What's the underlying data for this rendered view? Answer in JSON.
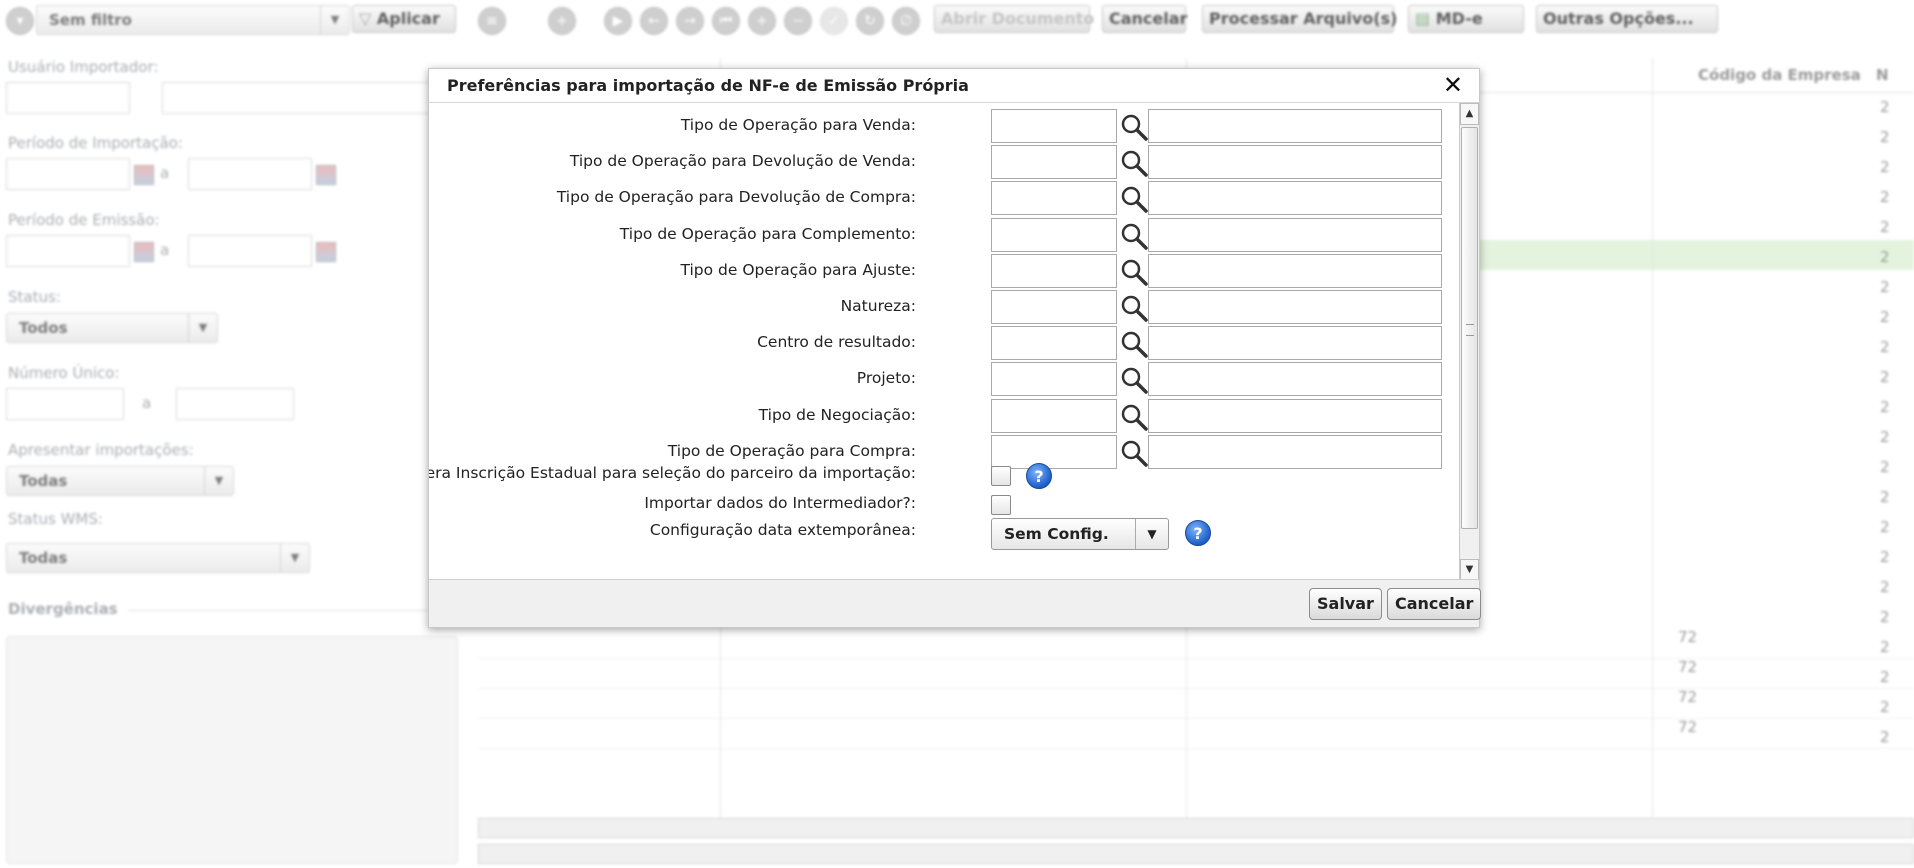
{
  "toolbar": {
    "filter_value": "Sem filtro",
    "apply_label": "Aplicar",
    "open_doc_label": "Abrir Documento",
    "cancel_label": "Cancelar",
    "process_label": "Processar Arquivo(s)",
    "mde_label": "MD-e",
    "more_label": "Outras Opções..."
  },
  "filters": {
    "user_label": "Usuário Importador:",
    "import_period_label": "Período de Importação:",
    "emission_period_label": "Período de Emissão:",
    "range_sep": "a",
    "status_label": "Status:",
    "status_value": "Todos",
    "unique_number_label": "Número Único:",
    "show_imports_label": "Apresentar importações:",
    "show_imports_value": "Todas",
    "wms_label": "Status WMS:",
    "wms_value": "Todas",
    "divergences_label": "Divergências"
  },
  "grid": {
    "company_code_header": "Código da Empresa",
    "last_header_letter": "N",
    "row_value": "72",
    "col_value": "2"
  },
  "modal": {
    "title": "Preferências para importação de NF-e de Emissão Própria",
    "fields": [
      {
        "label": "Tipo de Operação para Venda:"
      },
      {
        "label": "Tipo de Operação para Devolução de Venda:"
      },
      {
        "label": "Tipo de Operação para Devolução de Compra:"
      },
      {
        "label": "Tipo de Operação para Complemento:"
      },
      {
        "label": "Tipo de Operação para Ajuste:"
      },
      {
        "label": "Natureza:"
      },
      {
        "label": "Centro de resultado:"
      },
      {
        "label": "Projeto:"
      },
      {
        "label": "Tipo de Negociação:"
      },
      {
        "label": "Tipo de Operação para Compra:"
      }
    ],
    "checkbox_ie_label": "Considera Inscrição Estadual para seleção do parceiro da importação:",
    "checkbox_intermediary_label": "Importar dados do Intermediador?:",
    "date_config_label": "Configuração data extemporânea:",
    "date_config_value": "Sem Config.",
    "help_glyph": "?",
    "save_label": "Salvar",
    "cancel_label": "Cancelar",
    "close_glyph": "✕"
  },
  "icons": {
    "search": "magnifier-icon",
    "close": "close-icon",
    "help": "help-icon"
  }
}
